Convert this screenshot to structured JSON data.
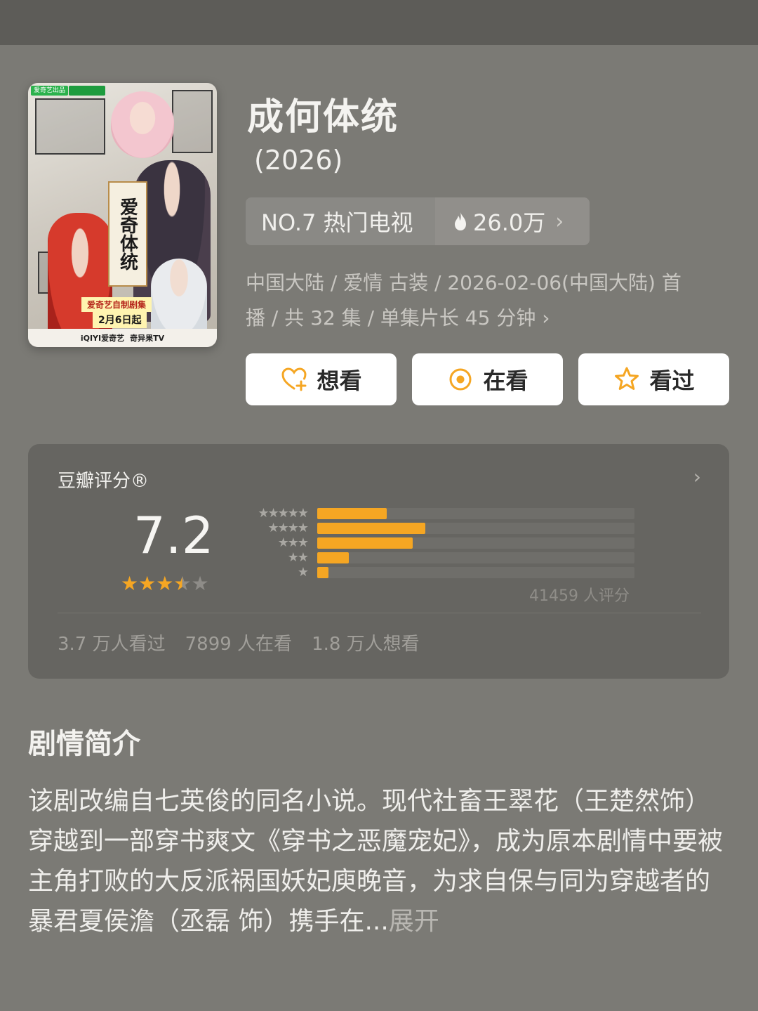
{
  "poster": {
    "badge": "爱奇艺出品",
    "scroll_text": "爱奇体统",
    "tag": "爱奇艺自制剧集",
    "date": "2月6日起",
    "footer_left": "iQIYI爱奇艺",
    "footer_right": "奇异果TV"
  },
  "header": {
    "title": "成何体统",
    "year": "(2026)"
  },
  "rank": {
    "rank_label": "NO.7 热门电视",
    "heat_value": "26.0万",
    "fire_icon": "fire-icon",
    "chevron": "›"
  },
  "meta": {
    "line1": "中国大陆 / 爱情 古装 / 2026-02-06(中国大陆) 首",
    "line2": "播 / 共 32 集 / 单集片长 45 分钟 ›"
  },
  "actions": {
    "want": "想看",
    "watching": "在看",
    "watched": "看过"
  },
  "rating": {
    "label": "豆瓣评分®",
    "arrow": "›",
    "score": "7.2",
    "score_stars": 3.5,
    "rating_count": "41459 人评分",
    "distribution": [
      {
        "stars": "★★★★★",
        "fraction": 0.22
      },
      {
        "stars": "★★★★",
        "fraction": 0.34
      },
      {
        "stars": "★★★",
        "fraction": 0.3
      },
      {
        "stars": "★★",
        "fraction": 0.1
      },
      {
        "stars": "★",
        "fraction": 0.035
      }
    ],
    "stats": {
      "watched": "3.7 万人看过",
      "watching": "7899 人在看",
      "want": "1.8 万人想看"
    }
  },
  "synopsis": {
    "title": "剧情简介",
    "text": "该剧改编自七英俊的同名小说。现代社畜王翠花（王楚然饰）穿越到一部穿书爽文《穿书之恶魔宠妃》，成为原本剧情中要被主角打败的大反派祸国妖妃庾晚音，为求自保与同为穿越者的暴君夏侯澹（丞磊 饰）携手在...",
    "more": "展开"
  },
  "colors": {
    "accent": "#f5a623",
    "background": "#7b7a75",
    "card": "#666561"
  }
}
